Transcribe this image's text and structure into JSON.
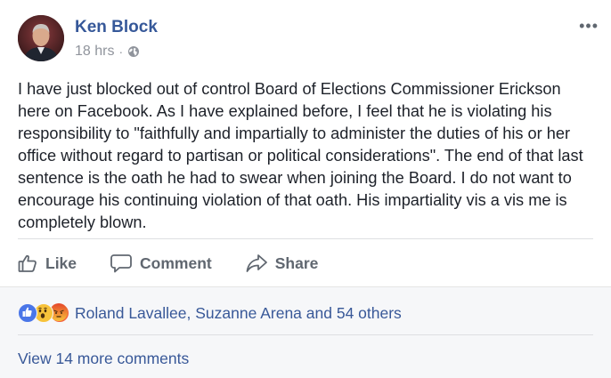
{
  "post": {
    "author": "Ken Block",
    "time": "18 hrs",
    "separator": "·",
    "privacy_icon": "globe-icon",
    "more_label": "•••",
    "text": "I have just blocked out of control Board of Elections Commissioner Erickson here on Facebook. As I have explained before, I feel that he is violating his responsibility to \"faithfully and impartially to administer the duties of his or her office without regard to partisan or political considerations\". The end of that last sentence is the oath he had to swear when joining the Board. I do not want to encourage his continuing violation of that oath. His impartiality vis a vis me is completely blown."
  },
  "actions": {
    "like": "Like",
    "comment": "Comment",
    "share": "Share"
  },
  "reactions": {
    "icons": [
      "like-reaction-icon",
      "wow-reaction-icon",
      "angry-reaction-icon"
    ],
    "summary": "Roland Lavallee, Suzanne Arena and 54 others"
  },
  "comments": {
    "view_more": "View 14 more comments"
  },
  "colors": {
    "link_blue": "#365899",
    "muted": "#90949c",
    "action_gray": "#606770",
    "footer_bg": "#f6f7f9"
  }
}
